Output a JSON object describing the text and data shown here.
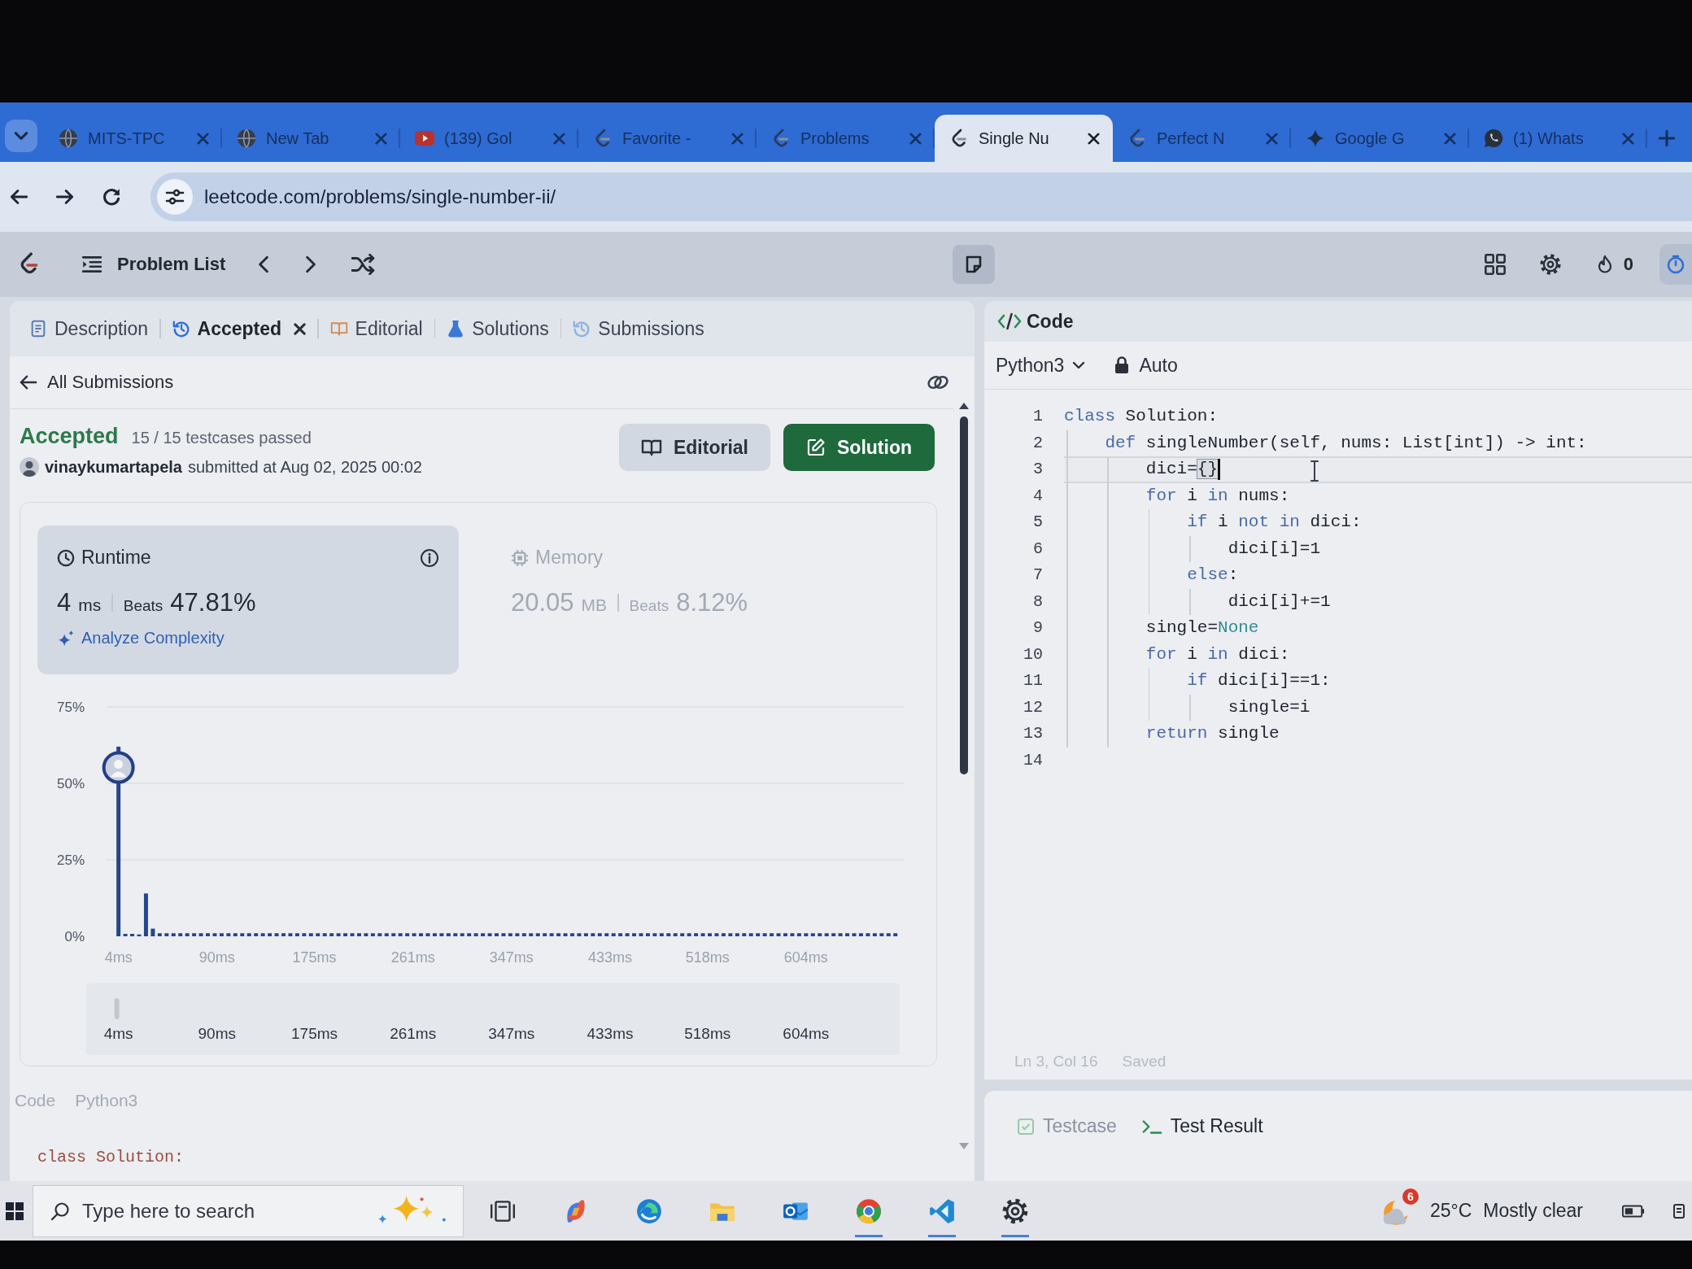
{
  "browser": {
    "tabs": [
      {
        "title": "MITS-TPC",
        "kind": "globe",
        "selected": false
      },
      {
        "title": "New Tab",
        "kind": "globe",
        "selected": false
      },
      {
        "title": "(139) Gol",
        "kind": "video",
        "selected": false
      },
      {
        "title": "Favorite -",
        "kind": "leetcode",
        "selected": false
      },
      {
        "title": "Problems",
        "kind": "leetcode",
        "selected": false
      },
      {
        "title": "Single Nu",
        "kind": "leetcode",
        "selected": true
      },
      {
        "title": "Perfect N",
        "kind": "leetcode",
        "selected": false
      },
      {
        "title": "Google G",
        "kind": "sparkle",
        "selected": false
      },
      {
        "title": "(1) Whats",
        "kind": "chat",
        "selected": false
      }
    ],
    "url": "leetcode.com/problems/single-number-ii/"
  },
  "toolbar": {
    "problem_list": "Problem List",
    "streak": "0"
  },
  "left_panel": {
    "tabs": [
      {
        "label": "Description",
        "kind": "description",
        "selected": false,
        "closable": false
      },
      {
        "label": "Accepted",
        "kind": "history",
        "selected": true,
        "closable": true
      },
      {
        "label": "Editorial",
        "kind": "book",
        "selected": false,
        "closable": false
      },
      {
        "label": "Solutions",
        "kind": "flask",
        "selected": false,
        "closable": false
      },
      {
        "label": "Submissions",
        "kind": "history",
        "selected": false,
        "closable": false
      }
    ]
  },
  "submission": {
    "back": "All Submissions",
    "status": "Accepted",
    "testcases": "15 / 15 testcases passed",
    "user": "vinaykumartapela",
    "submitted": "submitted at Aug 02, 2025 00:02",
    "buttons": [
      {
        "label": "Editorial",
        "kind": "secondary"
      },
      {
        "label": "Solution",
        "kind": "primary"
      }
    ],
    "metrics": [
      {
        "kind": "runtime",
        "title": "Runtime",
        "value": "4",
        "unit": "ms",
        "beats_label": "Beats",
        "beats": "47.81%",
        "action": "Analyze Complexity",
        "selected": true
      },
      {
        "kind": "memory",
        "title": "Memory",
        "value": "20.05",
        "unit": "MB",
        "beats_label": "Beats",
        "beats": "8.12%",
        "selected": false
      }
    ],
    "chart_data": {
      "type": "bar",
      "xlim": [
        0,
        690
      ],
      "ylim": [
        0,
        75
      ],
      "yticks": [
        {
          "value": 0,
          "label": "0%"
        },
        {
          "value": 25,
          "label": "25%"
        },
        {
          "value": 50,
          "label": "50%"
        },
        {
          "value": 75,
          "label": "75%"
        }
      ],
      "xticks": [
        {
          "value": 4,
          "label": "4ms"
        },
        {
          "value": 90,
          "label": "90ms"
        },
        {
          "value": 175,
          "label": "175ms"
        },
        {
          "value": 261,
          "label": "261ms"
        },
        {
          "value": 347,
          "label": "347ms"
        },
        {
          "value": 433,
          "label": "433ms"
        },
        {
          "value": 518,
          "label": "518ms"
        },
        {
          "value": 604,
          "label": "604ms"
        }
      ],
      "x": [
        4,
        10,
        16,
        22,
        28,
        34,
        40,
        46,
        52,
        58,
        64,
        70,
        76,
        82,
        88,
        94,
        100,
        106,
        112,
        118,
        124,
        130,
        136,
        142,
        148,
        154,
        160,
        166,
        172,
        178,
        184,
        190,
        196,
        202,
        208,
        214,
        220,
        226,
        232,
        238,
        244,
        250,
        256,
        262,
        268,
        274,
        280,
        286,
        292,
        298,
        304,
        310,
        316,
        322,
        328,
        334,
        340,
        346,
        352,
        358,
        364,
        370,
        376,
        382,
        388,
        394,
        400,
        406,
        412,
        418,
        424,
        430,
        436,
        442,
        448,
        454,
        460,
        466,
        472,
        478,
        484,
        490,
        496,
        502,
        508,
        514,
        520,
        526,
        532,
        538,
        544,
        550,
        556,
        562,
        568,
        574,
        580,
        586,
        592,
        598,
        604,
        610,
        616,
        622,
        628,
        634,
        640,
        646,
        652,
        658,
        664,
        670,
        676,
        682
      ],
      "series": [
        {
          "color": "#24468f",
          "values": [
            62,
            0.8,
            0.8,
            0.6,
            14,
            2.5,
            1,
            1,
            1,
            1,
            1,
            1,
            1,
            1,
            1,
            1,
            1,
            1,
            1,
            1,
            1,
            1,
            1,
            1,
            1,
            1,
            1,
            1,
            1,
            1,
            1,
            1,
            1,
            1,
            1,
            1,
            1,
            1,
            1,
            1,
            1,
            1,
            1,
            1,
            1,
            1,
            1,
            1,
            1,
            1,
            1,
            1,
            1,
            1,
            1,
            1,
            1,
            1,
            1,
            1,
            1,
            1,
            1,
            1,
            1,
            1,
            1,
            1,
            1,
            1,
            1,
            1,
            1,
            1,
            1,
            1,
            1,
            1,
            1,
            1,
            1,
            1,
            1,
            1,
            1,
            1,
            1,
            1,
            1,
            1,
            1,
            1,
            1,
            1,
            1,
            1,
            1,
            1,
            1,
            1,
            1,
            1,
            1,
            1,
            1,
            1,
            1,
            1,
            1,
            1,
            1,
            1,
            1,
            1
          ]
        }
      ]
    },
    "range_labels": [
      "4ms",
      "90ms",
      "175ms",
      "261ms",
      "347ms",
      "433ms",
      "518ms",
      "604ms"
    ],
    "code_preview": {
      "title": "Code",
      "language": "Python3",
      "lines": [
        "class Solution:"
      ]
    }
  },
  "editor": {
    "title": "Code",
    "language": "Python3",
    "mode": "Auto",
    "status": "Ln 3, Col 16",
    "saved": "Saved",
    "lines": [
      {
        "number": "1",
        "current": false,
        "tokens": [
          {
            "kind": "keyword",
            "text": "class"
          },
          {
            "kind": "plain",
            "text": " Solution:"
          }
        ],
        "children": [
          {
            "number": "2",
            "current": false,
            "tokens": [
              {
                "kind": "keyword",
                "text": "def"
              },
              {
                "kind": "plain",
                "text": " singleNumber(self, nums: List[int]) -> int:"
              }
            ],
            "children": [
              {
                "number": "3",
                "current": true,
                "tokens": [
                  {
                    "kind": "plain",
                    "text": "dici="
                  },
                  {
                    "kind": "bracket",
                    "text": "{}"
                  }
                ]
              },
              {
                "number": "4",
                "current": false,
                "tokens": [
                  {
                    "kind": "keyword",
                    "text": "for"
                  },
                  {
                    "kind": "plain",
                    "text": " i "
                  },
                  {
                    "kind": "keyword",
                    "text": "in"
                  },
                  {
                    "kind": "plain",
                    "text": " nums:"
                  }
                ],
                "children": [
                  {
                    "number": "5",
                    "current": false,
                    "tokens": [
                      {
                        "kind": "keyword",
                        "text": "if"
                      },
                      {
                        "kind": "plain",
                        "text": " i "
                      },
                      {
                        "kind": "keyword",
                        "text": "not in"
                      },
                      {
                        "kind": "plain",
                        "text": " dici:"
                      }
                    ],
                    "children": [
                      {
                        "number": "6",
                        "current": false,
                        "tokens": [
                          {
                            "kind": "plain",
                            "text": "dici[i]=1"
                          }
                        ]
                      }
                    ]
                  },
                  {
                    "number": "7",
                    "current": false,
                    "tokens": [
                      {
                        "kind": "keyword",
                        "text": "else"
                      },
                      {
                        "kind": "plain",
                        "text": ":"
                      }
                    ],
                    "children": [
                      {
                        "number": "8",
                        "current": false,
                        "tokens": [
                          {
                            "kind": "plain",
                            "text": "dici[i]+=1"
                          }
                        ]
                      }
                    ]
                  }
                ]
              },
              {
                "number": "9",
                "current": false,
                "tokens": [
                  {
                    "kind": "plain",
                    "text": "single="
                  },
                  {
                    "kind": "constant",
                    "text": "None"
                  }
                ]
              },
              {
                "number": "10",
                "current": false,
                "tokens": [
                  {
                    "kind": "keyword",
                    "text": "for"
                  },
                  {
                    "kind": "plain",
                    "text": " i "
                  },
                  {
                    "kind": "keyword",
                    "text": "in"
                  },
                  {
                    "kind": "plain",
                    "text": " dici:"
                  }
                ],
                "children": [
                  {
                    "number": "11",
                    "current": false,
                    "tokens": [
                      {
                        "kind": "keyword",
                        "text": "if"
                      },
                      {
                        "kind": "plain",
                        "text": " dici[i]==1:"
                      }
                    ],
                    "children": [
                      {
                        "number": "12",
                        "current": false,
                        "tokens": [
                          {
                            "kind": "plain",
                            "text": "single=i"
                          }
                        ]
                      }
                    ]
                  }
                ]
              },
              {
                "number": "13",
                "current": false,
                "tokens": [
                  {
                    "kind": "keyword",
                    "text": "return"
                  },
                  {
                    "kind": "plain",
                    "text": " single"
                  }
                ]
              }
            ]
          }
        ]
      },
      {
        "number": "14",
        "current": false
      }
    ]
  },
  "console": {
    "tabs": [
      {
        "label": "Testcase",
        "kind": "testcase",
        "selected": false
      },
      {
        "label": "Test Result",
        "kind": "result",
        "selected": true
      }
    ]
  },
  "taskbar": {
    "search_placeholder": "Type here to search",
    "apps": [
      {
        "kind": "task-view",
        "running": false
      },
      {
        "kind": "swirl",
        "running": false
      },
      {
        "kind": "wave",
        "running": false
      },
      {
        "kind": "folder",
        "running": false
      },
      {
        "kind": "mail",
        "running": false
      },
      {
        "kind": "ring",
        "running": true
      },
      {
        "kind": "ribbon",
        "running": true
      },
      {
        "kind": "gear",
        "running": true
      }
    ],
    "weather": {
      "badge": "6",
      "temperature": "25°C",
      "condition": "Mostly clear"
    }
  }
}
